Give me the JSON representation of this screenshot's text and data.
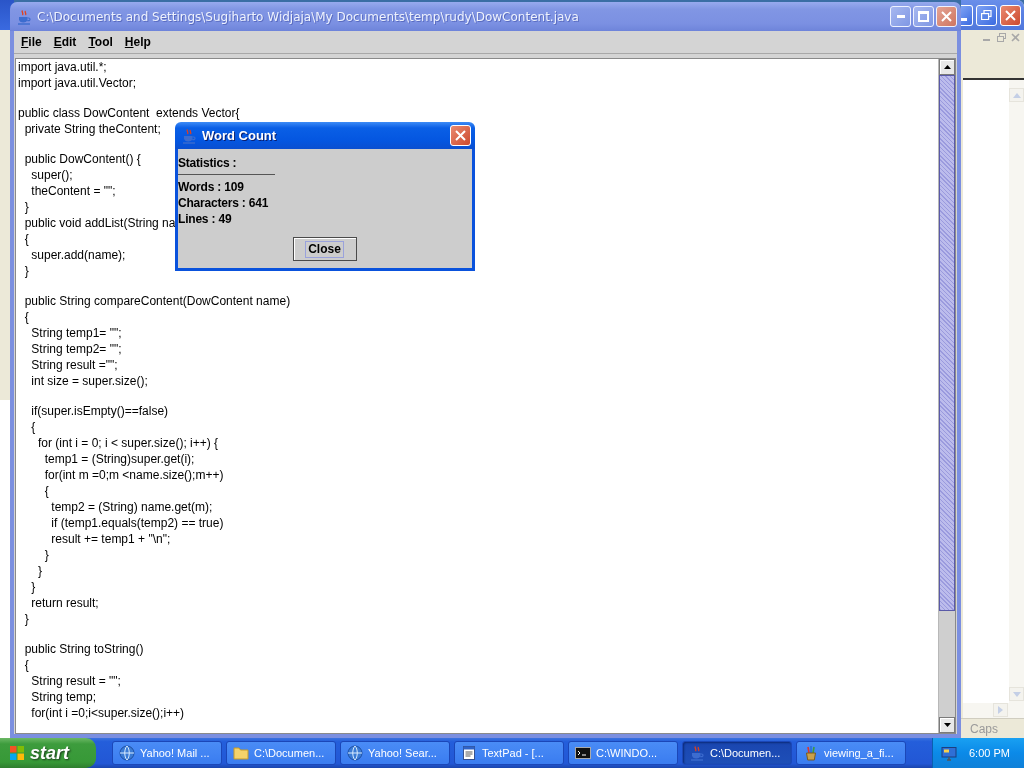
{
  "background_window": {
    "status_text": "Caps"
  },
  "window": {
    "title": "C:\\Documents and Settings\\Sugiharto Widjaja\\My Documents\\temp\\rudy\\DowContent.java",
    "menu": [
      "File",
      "Edit",
      "Tool",
      "Help"
    ],
    "editor": {
      "blocks": [
        [
          "import java.util.*;",
          "import java.util.Vector;"
        ],
        [
          "public class DowContent  extends Vector{",
          "  private String theContent;"
        ],
        [
          "  public DowContent() {",
          "    super();",
          "    theContent = \"\";",
          "  }",
          "  public void addList(String na",
          "  {",
          "    super.add(name);",
          "  }"
        ],
        [
          "  public String compareContent(DowContent name)",
          "  {",
          "    String temp1= \"\";",
          "    String temp2= \"\";",
          "    String result =\"\";",
          "    int size = super.size();"
        ],
        [
          "    if(super.isEmpty()==false)",
          "    {",
          "      for (int i = 0; i < super.size(); i++) {",
          "        temp1 = (String)super.get(i);",
          "        for(int m =0;m <name.size();m++)",
          "        {",
          "          temp2 = (String) name.get(m);",
          "          if (temp1.equals(temp2) == true)",
          "          result += temp1 + \"\\n\";",
          "        }",
          "      }",
          "    }",
          "    return result;",
          "  }"
        ],
        [
          "  public String toString()",
          "  {",
          "    String result = \"\";",
          "    String temp;",
          "    for(int i =0;i<super.size();i++)"
        ]
      ]
    }
  },
  "dialog": {
    "title": "Word Count",
    "heading": "Statistics :",
    "stats": [
      "Words : 109",
      "Characters : 641",
      "Lines : 49"
    ],
    "button": "Close"
  },
  "taskbar": {
    "start": "start",
    "tasks": [
      {
        "label": "Yahoo! Mail ...",
        "kind": "browser",
        "selected": false
      },
      {
        "label": "C:\\Documen...",
        "kind": "folder",
        "selected": false
      },
      {
        "label": "Yahoo! Sear...",
        "kind": "browser",
        "selected": false
      },
      {
        "label": "TextPad - [...",
        "kind": "editor",
        "selected": false
      },
      {
        "label": "C:\\WINDO...",
        "kind": "console",
        "selected": false
      },
      {
        "label": "C:\\Documen...",
        "kind": "java",
        "selected": true
      },
      {
        "label": "viewing_a_fi...",
        "kind": "paint",
        "selected": false
      }
    ],
    "clock": "6:00 PM"
  }
}
